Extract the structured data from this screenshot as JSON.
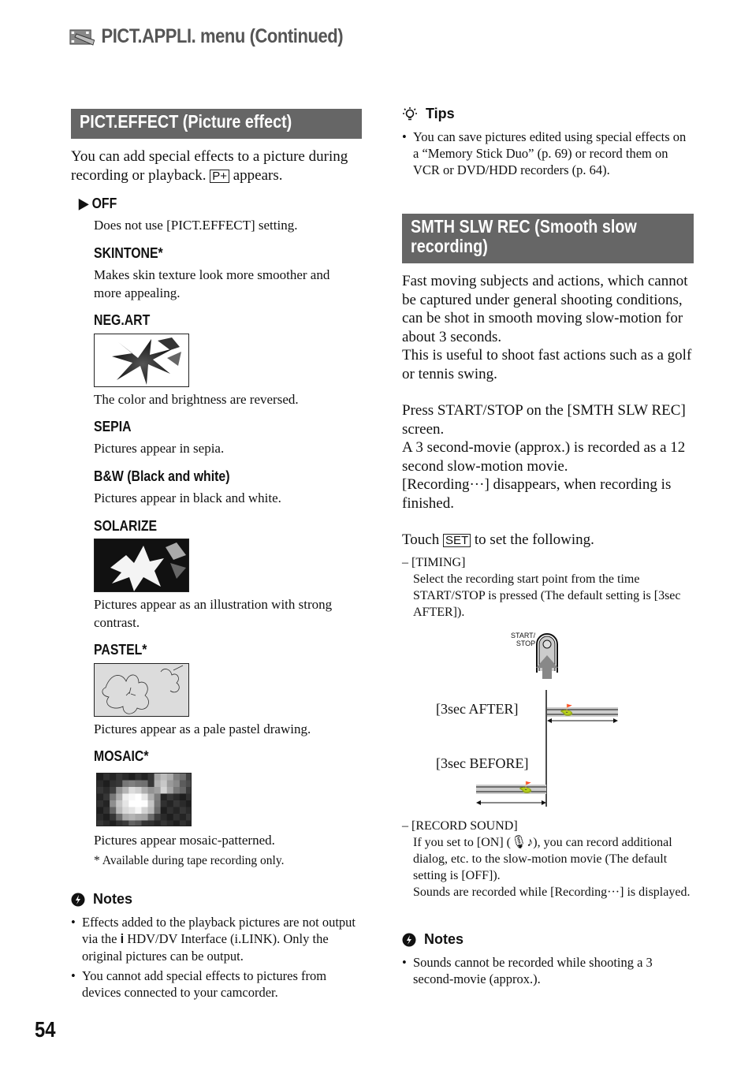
{
  "header": {
    "title": "PICT.APPLI. menu (Continued)",
    "icon": "film-edit-icon"
  },
  "left": {
    "section_title": "PICT.EFFECT (Picture effect)",
    "intro_before": "You can add special effects to a picture during recording or playback.",
    "intro_icon": "P+",
    "intro_after": "appears.",
    "default_marker": "▶",
    "items": [
      {
        "name": "OFF",
        "desc": "Does not use [PICT.EFFECT] setting.",
        "default": true
      },
      {
        "name": "SKINTONE*",
        "desc": "Makes skin texture look more smoother and more appealing."
      },
      {
        "name": "NEG.ART",
        "desc": "The color and brightness are reversed.",
        "image": "negative-lily"
      },
      {
        "name": "SEPIA",
        "desc": "Pictures appear in sepia."
      },
      {
        "name": "B&W (Black and white)",
        "desc": "Pictures appear in black and white."
      },
      {
        "name": "SOLARIZE",
        "desc": "Pictures appear as an illustration with strong contrast.",
        "image": "solarized-lily"
      },
      {
        "name": "PASTEL*",
        "desc": "Pictures appear as a pale pastel drawing.",
        "image": "pastel-lily"
      },
      {
        "name": "MOSAIC*",
        "desc": "Pictures appear mosaic-patterned.",
        "image": "mosaic-lily"
      }
    ],
    "footnote": "*  Available during tape recording only.",
    "notes": {
      "title": "Notes",
      "bullets": [
        {
          "before": "Effects added to the playback pictures are not output via the",
          "icon": "i",
          "after": "HDV/DV Interface (i.LINK). Only the original pictures can be output."
        },
        {
          "text": "You cannot add special effects to pictures from devices connected to your camcorder."
        }
      ]
    }
  },
  "right": {
    "tips": {
      "title": "Tips",
      "bullets": [
        "You can save pictures edited using special effects on a “Memory Stick Duo” (p. 69) or record them on VCR or DVD/HDD recorders (p. 64)."
      ]
    },
    "section_title": "SMTH SLW REC (Smooth slow recording)",
    "para1": "Fast moving subjects and actions, which cannot be captured under general shooting conditions, can be shot in smooth moving slow-motion for about 3 seconds.",
    "para2": "This is useful to shoot fast actions such as a golf or tennis swing.",
    "para3": "Press START/STOP on the [SMTH SLW REC] screen.",
    "para4": "A 3 second-movie (approx.) is recorded as a 12 second slow-motion movie.",
    "para5": "[Recording···] disappears, when recording is finished.",
    "touch_before": "Touch",
    "touch_button": "SET",
    "touch_after": "to set the following.",
    "timing_label": "– [TIMING]",
    "timing_desc": "Select the recording start point from the time START/STOP is pressed (The default setting is [3sec AFTER]).",
    "diagram": {
      "button_label_1": "START/",
      "button_label_2": "STOP",
      "after_label": "[3sec AFTER]",
      "before_label": "[3sec BEFORE]"
    },
    "sound_label": "– [RECORD SOUND]",
    "sound_desc_before": "If you set to [ON] (",
    "sound_desc_after": "), you can record additional dialog, etc. to the slow-motion movie (The default setting is [OFF]).",
    "sound_desc2": "Sounds are recorded while [Recording···] is displayed.",
    "notes": {
      "title": "Notes",
      "bullets": [
        "Sounds cannot be recorded while shooting a 3 second-movie (approx.)."
      ]
    }
  },
  "page_number": "54"
}
